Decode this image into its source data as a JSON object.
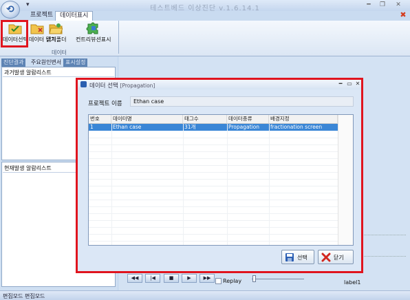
{
  "window": {
    "title": "테스트베드 이상진단 v.1.6.14.1",
    "controls": {
      "minimize": "━",
      "maximize": "❐",
      "close": "✕"
    }
  },
  "ribbon": {
    "tabs": [
      "프로젝트",
      "데이터표시"
    ],
    "active_tab": "데이터표시",
    "buttons": [
      {
        "label": "데이터선택",
        "icon": "folder-check-icon"
      },
      {
        "label": "데이터 닫기",
        "icon": "folder-close-icon"
      },
      {
        "label": "캡쳐폴더",
        "icon": "folder-open-icon"
      },
      {
        "label": "컨트리뷰션표시",
        "icon": "puzzle-icon"
      }
    ],
    "group_label": "데이터",
    "close_glyph": "✖"
  },
  "left_panel": {
    "tabs": [
      "진단결과",
      "주요원인변서",
      "표시설정"
    ],
    "past_alarm_title": "과거발생 알람리스트",
    "current_alarm_title": "현재발생 알람리스트"
  },
  "player": {
    "buttons": [
      "◀◀",
      "|◀",
      "■",
      "▶",
      "▶▶"
    ],
    "replay_label": "Replay",
    "label1": "label1"
  },
  "statusbar": {
    "text": "편집모드 편집모드"
  },
  "dialog": {
    "title": "데이터 선택",
    "title_en": "[Propagation]",
    "controls": {
      "minimize": "━",
      "maximize": "▭",
      "close": "✕"
    },
    "project_label": "프로젝트 이름",
    "project_value": "Ethan case",
    "grid": {
      "columns": [
        "번호",
        "데이터명",
        "태그수",
        "데이터종류",
        "배경지정"
      ],
      "rows": [
        [
          "1",
          "Ethan case",
          "31개",
          "Propagation",
          "fractionation screen"
        ]
      ]
    },
    "buttons": {
      "select": "선택",
      "close": "닫기"
    }
  },
  "colors": {
    "highlight": "#e0141e",
    "selection": "#3a86d6",
    "panel_bg": "#c9dbf0"
  }
}
